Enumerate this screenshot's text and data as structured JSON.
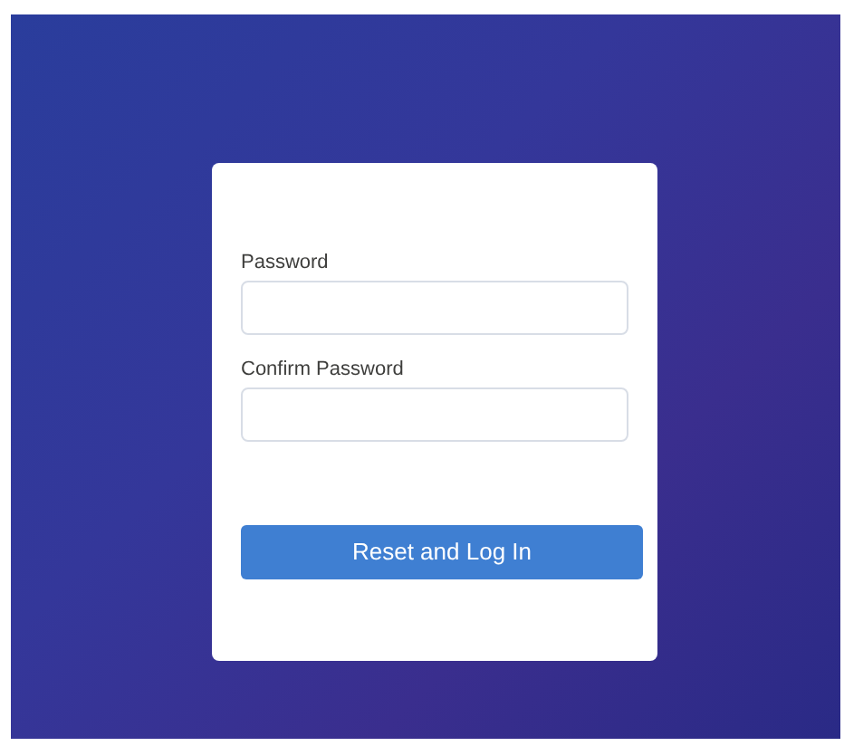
{
  "fields": [
    {
      "label": "Password"
    },
    {
      "label": "Confirm Password"
    }
  ],
  "button": {
    "label": "Reset and Log In"
  }
}
